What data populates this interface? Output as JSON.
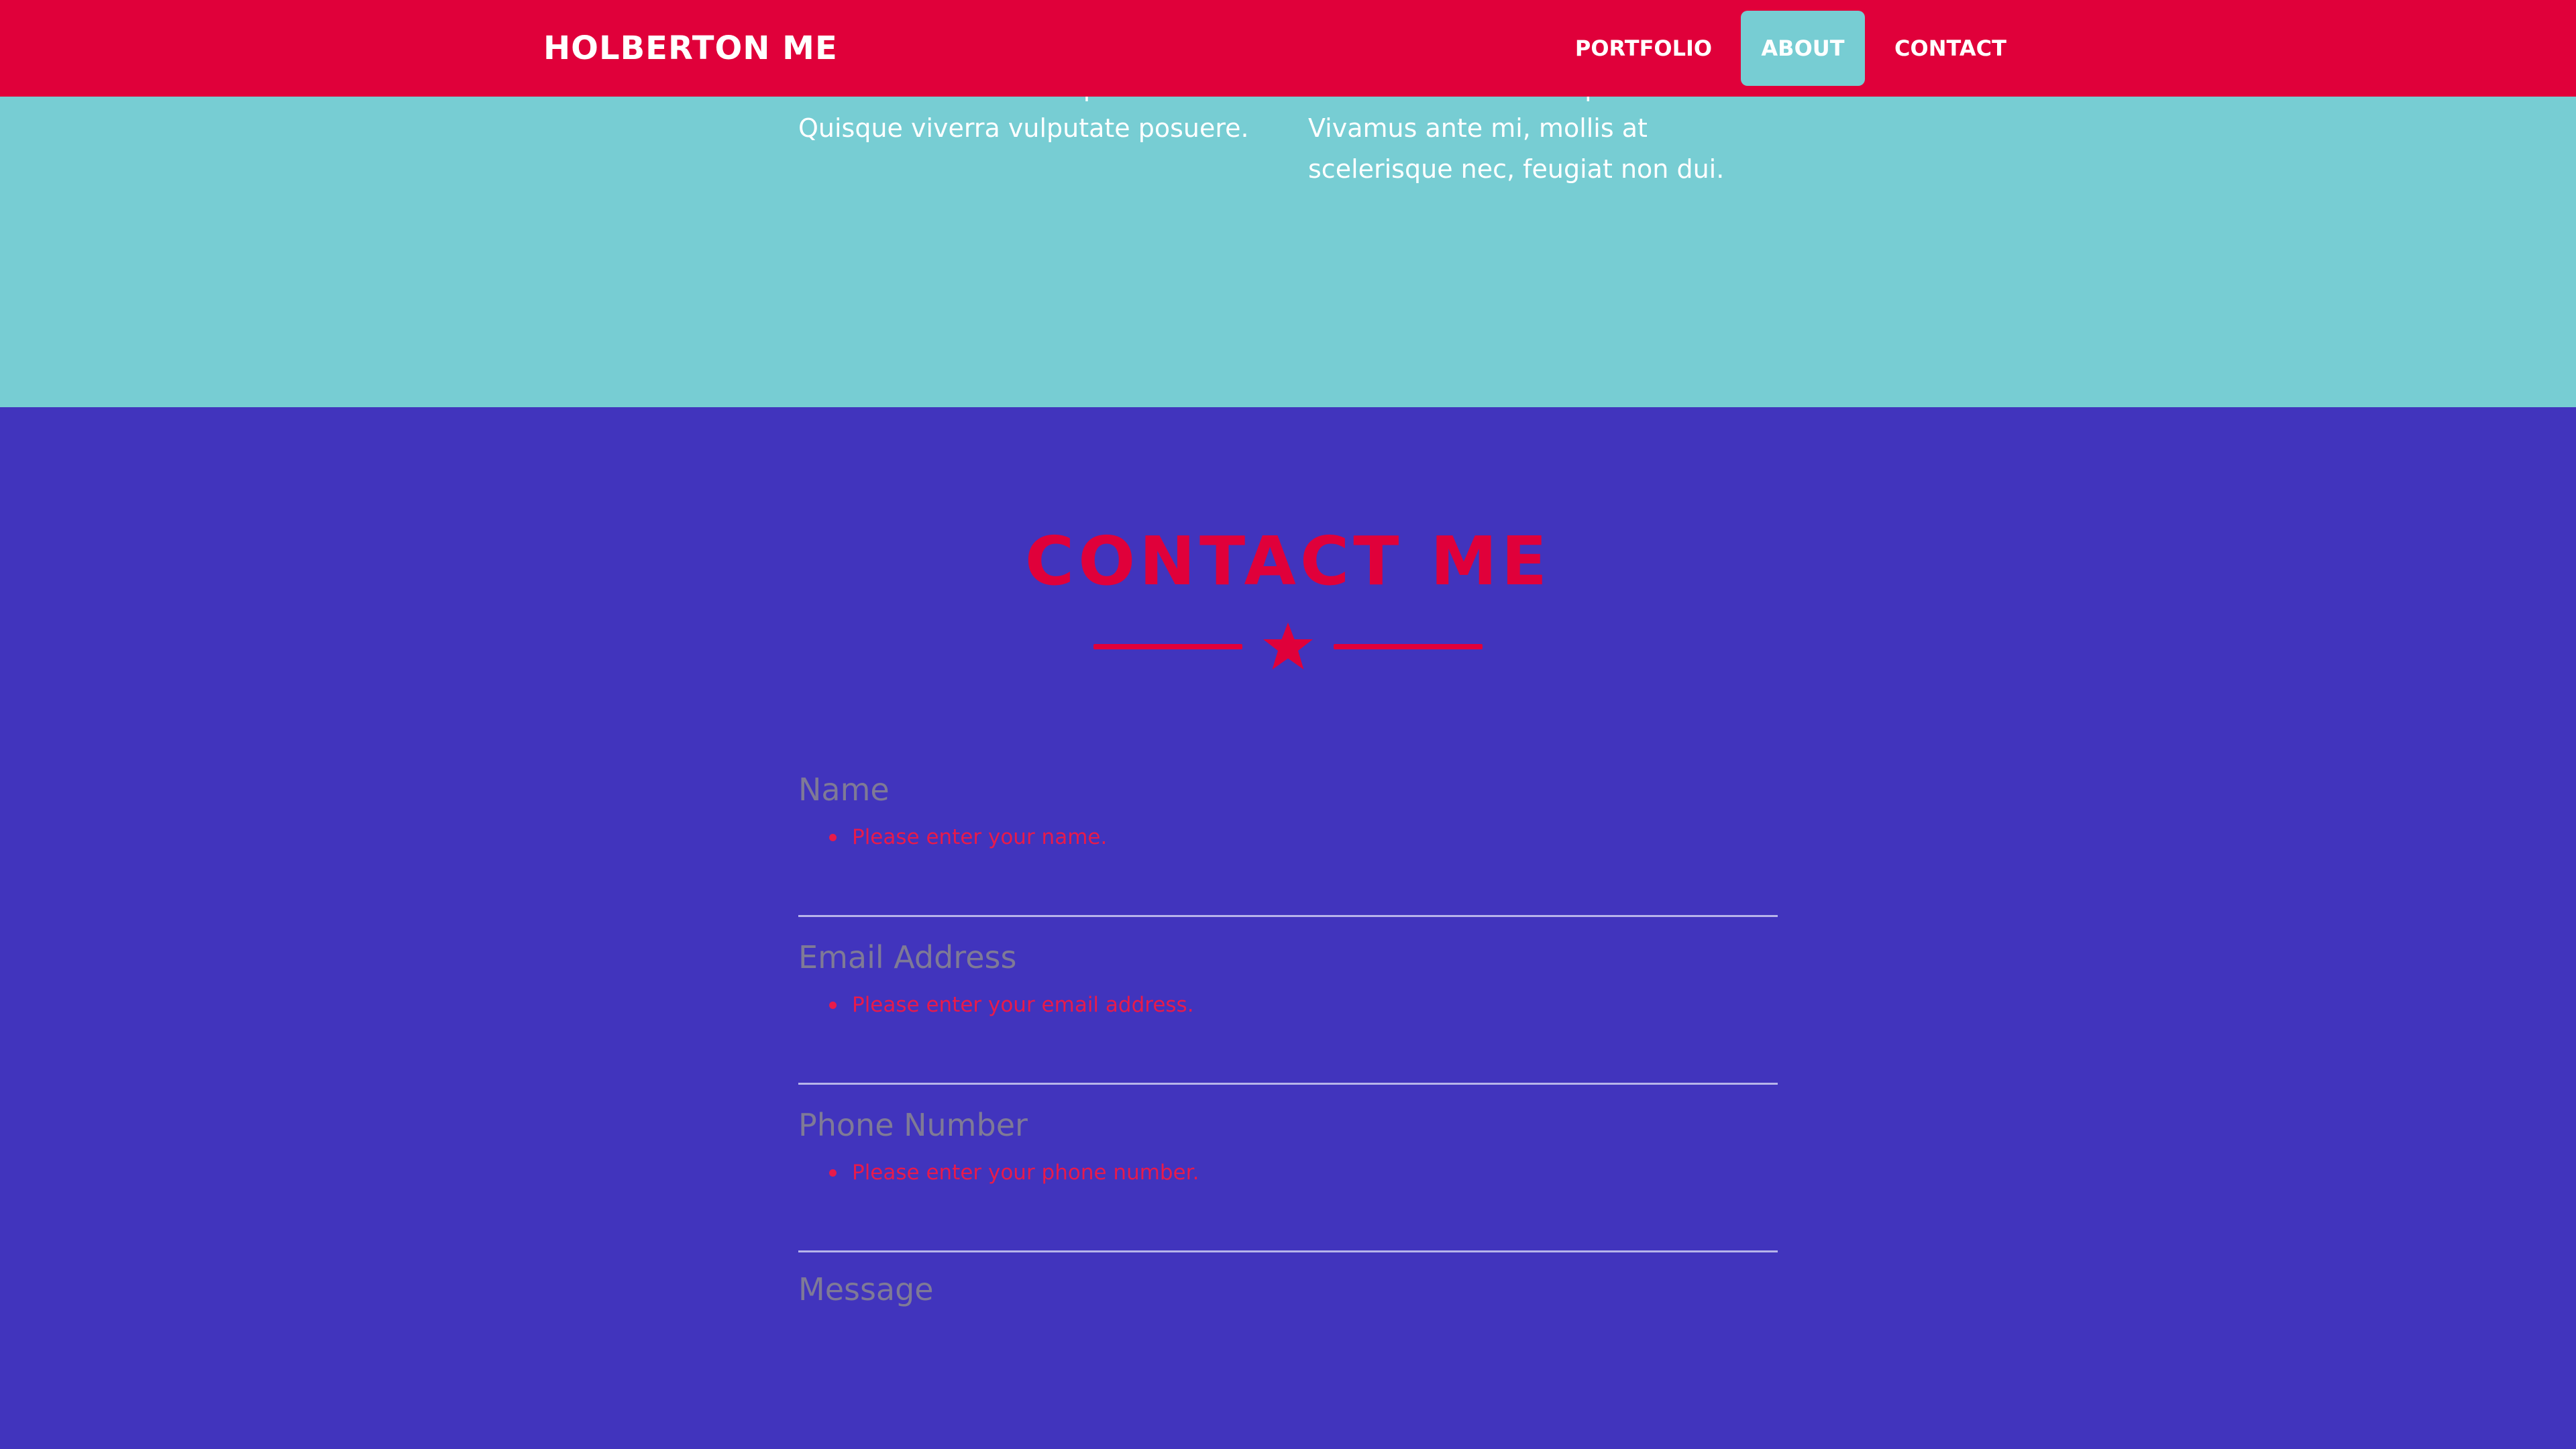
{
  "navbar": {
    "brand": "HOLBERTON ME",
    "items": [
      {
        "label": "PORTFOLIO",
        "active": false
      },
      {
        "label": "ABOUT",
        "active": true
      },
      {
        "label": "CONTACT",
        "active": false
      }
    ]
  },
  "about": {
    "left_text": "orci non risus scelerisque bibendum. Quisque viverra vulputate posuere.",
    "right_text": "sed finibus velit tristique vel. Vivamus ante mi, mollis at scelerisque nec, feugiat non dui."
  },
  "contact": {
    "title": "CONTACT ME",
    "divider_icon": "star-icon",
    "fields": [
      {
        "label": "Name",
        "error": "Please enter your name."
      },
      {
        "label": "Email Address",
        "error": "Please enter your email address."
      },
      {
        "label": "Phone Number",
        "error": "Please enter your phone number."
      },
      {
        "label": "Message"
      }
    ]
  },
  "colors": {
    "nav_bg": "#e0003a",
    "about_bg": "#77cdd3",
    "contact_bg": "#4134bd",
    "accent": "#e0003a",
    "error": "#e81a4b"
  }
}
